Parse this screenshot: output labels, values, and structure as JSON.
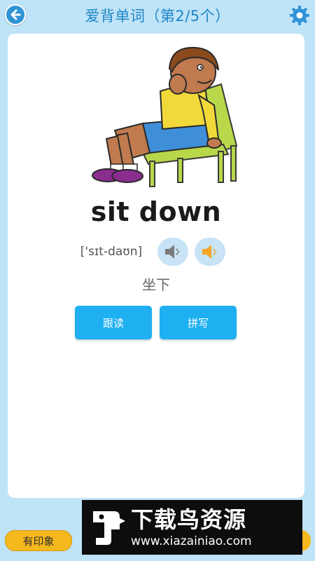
{
  "header": {
    "title": "爱背单词（第2/5个）",
    "back_icon": "arrow-left-icon",
    "settings_icon": "gear-icon"
  },
  "word_card": {
    "illustration": "boy-sitting-on-chair-illustration",
    "word": "sit down",
    "phonetic": "['sɪt-daʊn]",
    "speaker_slow_icon": "speaker-icon",
    "speaker_normal_icon": "speaker-icon",
    "meaning": "坐下",
    "follow_read_label": "跟读",
    "spell_label": "拼写"
  },
  "footer": {
    "impression_label": "有印象"
  },
  "watermark": {
    "title": "下载鸟资源",
    "url": "www.xiazainiao.com"
  },
  "colors": {
    "background": "#bfe3f7",
    "accent": "#1fb0f2",
    "title": "#1f86c7",
    "impression": "#f5b81d"
  }
}
